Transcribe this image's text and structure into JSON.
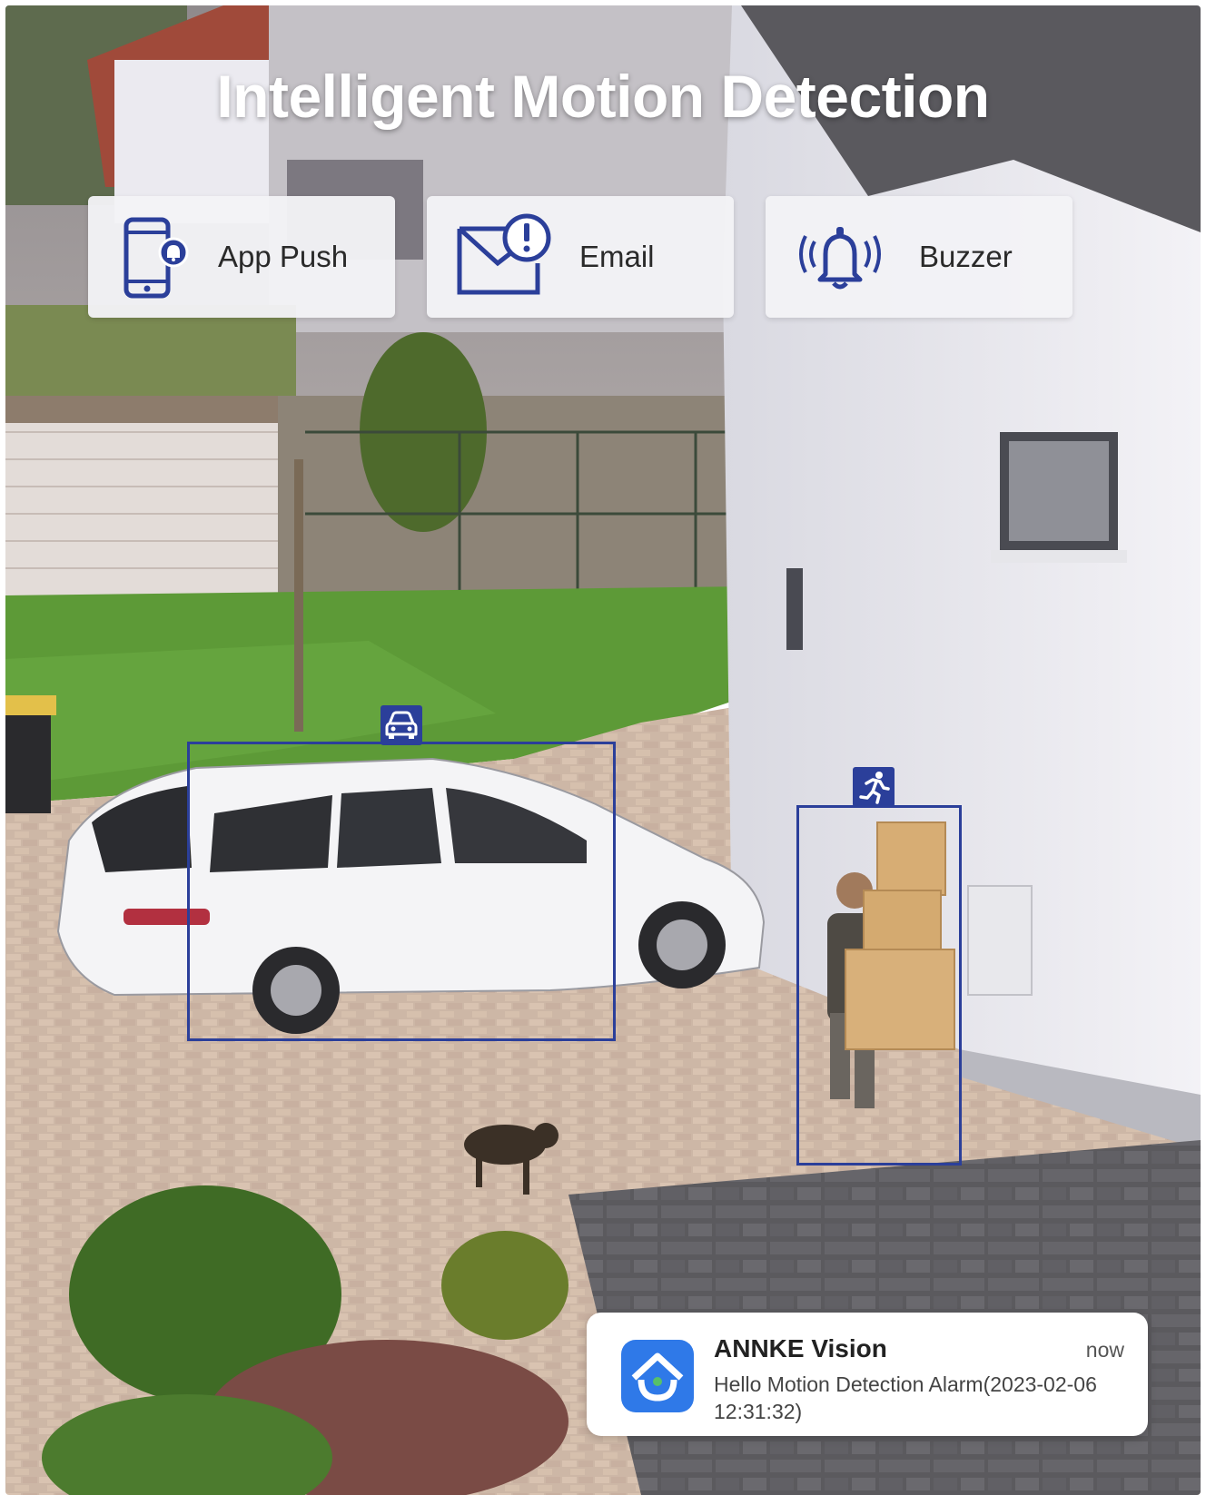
{
  "title": "Intelligent Motion Detection",
  "alert_methods": [
    {
      "label": "App Push",
      "icon": "phone-alert-icon"
    },
    {
      "label": "Email",
      "icon": "envelope-alert-icon"
    },
    {
      "label": "Buzzer",
      "icon": "ringing-bell-icon"
    }
  ],
  "detections": [
    {
      "type": "vehicle",
      "icon": "car-icon"
    },
    {
      "type": "person",
      "icon": "running-person-icon"
    }
  ],
  "notification": {
    "app_name": "ANNKE Vision",
    "time": "now",
    "message": "Hello Motion Detection Alarm(2023-02-06 12:31:32)",
    "icon": "home-app-icon"
  },
  "colors": {
    "accent": "#2b3f9a",
    "card_bg": "#f2f3f6",
    "app_icon_bg": "#2f79e8",
    "title_text": "#ffffff"
  }
}
